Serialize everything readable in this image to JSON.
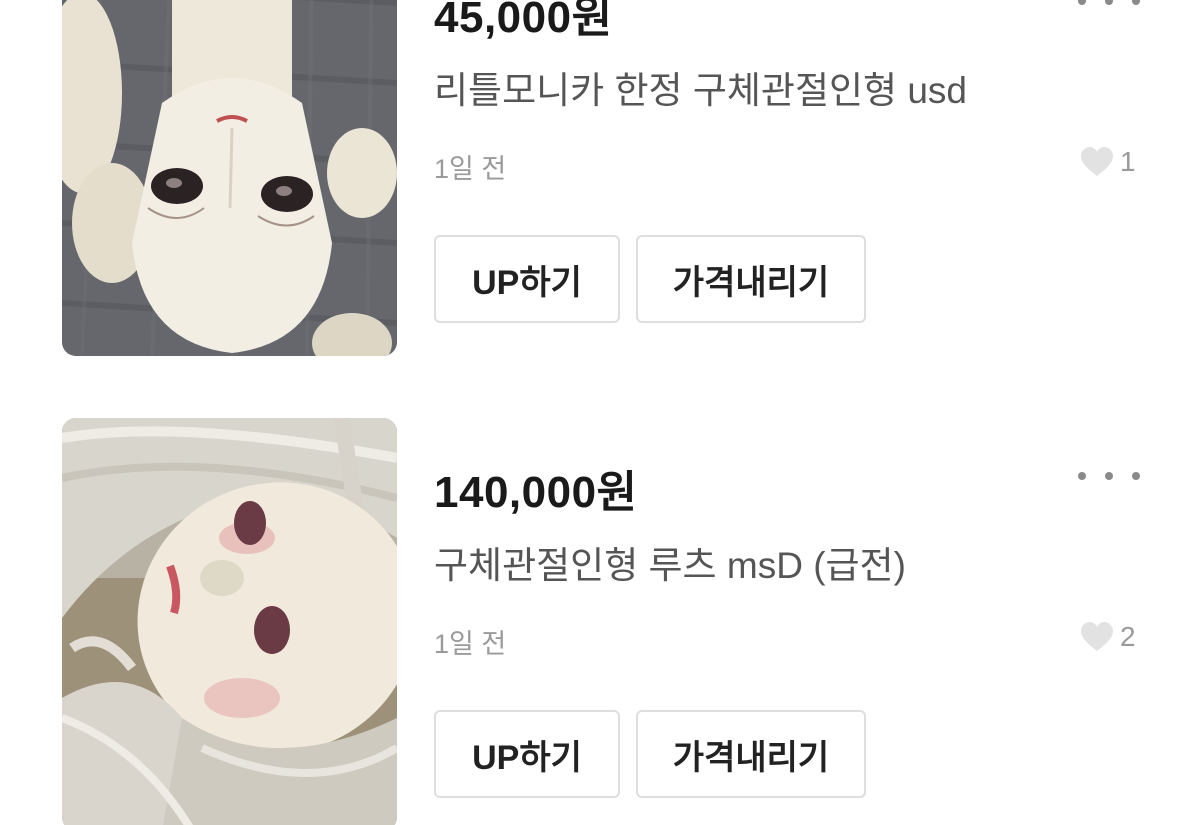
{
  "listings": [
    {
      "price": "45,000원",
      "title": "리틀모니카 한정 구체관절인형 usd",
      "time": "1일 전",
      "likes": "1",
      "image_icon": "doll-photo-icon",
      "buttons": {
        "up": "UP하기",
        "price_down": "가격내리기"
      }
    },
    {
      "price": "140,000원",
      "title": "구체관절인형 루츠 msD (급전)",
      "time": "1일 전",
      "likes": "2",
      "image_icon": "doll-photo-icon",
      "buttons": {
        "up": "UP하기",
        "price_down": "가격내리기"
      }
    }
  ],
  "colors": {
    "price_text": "#1a1a1a",
    "title_text": "#555555",
    "meta_text": "#9a9a9a",
    "button_border": "#dedede",
    "heart_fill": "#e2e2e2"
  },
  "icons": {
    "more": "more-horizontal-icon",
    "like": "heart-icon"
  }
}
